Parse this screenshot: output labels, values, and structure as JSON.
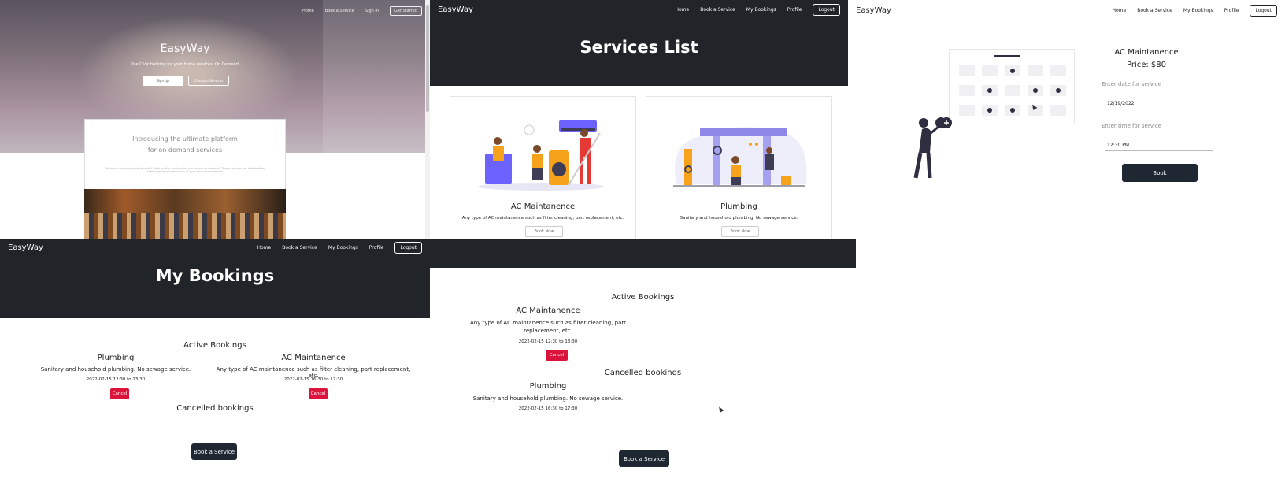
{
  "brand": "EasyWay",
  "nav": {
    "home": "Home",
    "book": "Book a Service",
    "bookings": "My Bookings",
    "profile": "Profile",
    "logout": "Logout",
    "signin": "Sign In",
    "getstarted": "Get Started"
  },
  "landing": {
    "title": "EasyWay",
    "subtitle": "One Click booking for your home services. On Demand.",
    "signup": "Sign Up",
    "checkout": "Checkout Services",
    "intro_line1": "Introducing the ultimate platform",
    "intro_line2": "for on demand services",
    "intro_text": "We help customers book reliable & high quality services for your home on demand. These services are delivered by highly trained professionals at your time and schedule."
  },
  "services_page": {
    "title": "Services List",
    "cards": [
      {
        "name": "AC Maintanence",
        "desc": "Any type of AC maintanence such as filter cleaning, part replacement, etc.",
        "button": "Book Now"
      },
      {
        "name": "Plumbing",
        "desc": "Sanitary and household plumbing. No sewage service.",
        "button": "Book Now"
      }
    ]
  },
  "booking_form": {
    "service": "AC Maintanence",
    "price": "Price: $80",
    "date_label": "Enter date for service",
    "date_value": "12/19/2022",
    "time_label": "Enter time for service",
    "time_value": "12:30 PM",
    "button": "Book"
  },
  "my_bookings": {
    "title": "My Bookings",
    "active_title": "Active Bookings",
    "cancelled_title": "Cancelled bookings",
    "active": [
      {
        "name": "Plumbing",
        "desc": "Sanitary and household plumbing. No sewage service.",
        "time": "2022-02-15 12:30 to 13:30",
        "button": "Cancel"
      },
      {
        "name": "AC Maintanence",
        "desc": "Any type of AC maintanence such as filter cleaning, part replacement, etc.",
        "time": "2022-02-15 16:30 to 17:30",
        "button": "Cancel"
      }
    ],
    "book_button": "Book a Service"
  },
  "my_bookings_after": {
    "active_title": "Active Bookings",
    "cancelled_title": "Cancelled bookings",
    "active": [
      {
        "name": "AC Maintanence",
        "desc_line1": "Any type of AC maintanence such as filter cleaning, part",
        "desc_line2": "replacement, etc.",
        "time": "2022-02-15 12:30 to 13:30",
        "button": "Cancel"
      }
    ],
    "cancelled": [
      {
        "name": "Plumbing",
        "desc": "Sanitary and household plumbing. No sewage service.",
        "time": "2022-02-15 16:30 to 17:30"
      }
    ],
    "book_button": "Book a Service"
  },
  "colors": {
    "dark": "#212529",
    "button_dark": "#1f2733",
    "cancel": "#dc143c",
    "illustration_accent": "#6c63ff",
    "illustration_orange": "#f7a21b"
  }
}
